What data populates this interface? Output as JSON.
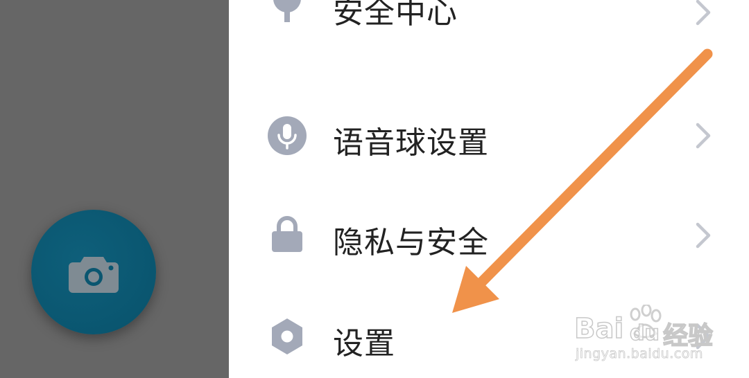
{
  "camera_button": {
    "icon": "camera-icon"
  },
  "menu": {
    "items": [
      {
        "label": "安全中心",
        "icon": "security-center-icon"
      },
      {
        "label": "语音球设置",
        "icon": "microphone-icon"
      },
      {
        "label": "隐私与安全",
        "icon": "lock-icon"
      },
      {
        "label": "设置",
        "icon": "settings-hexagon-icon"
      }
    ]
  },
  "watermark": {
    "brand_latin_1": "Bai",
    "brand_latin_2": "du",
    "brand_cn": "经验",
    "url": "jingyan.baidu.com"
  },
  "colors": {
    "overlay": "#666666",
    "camera_button": "#0a5670",
    "icon_gray": "#a3a9b8",
    "chevron": "#c4c7cf",
    "arrow": "#f0924a",
    "text": "#222222"
  }
}
